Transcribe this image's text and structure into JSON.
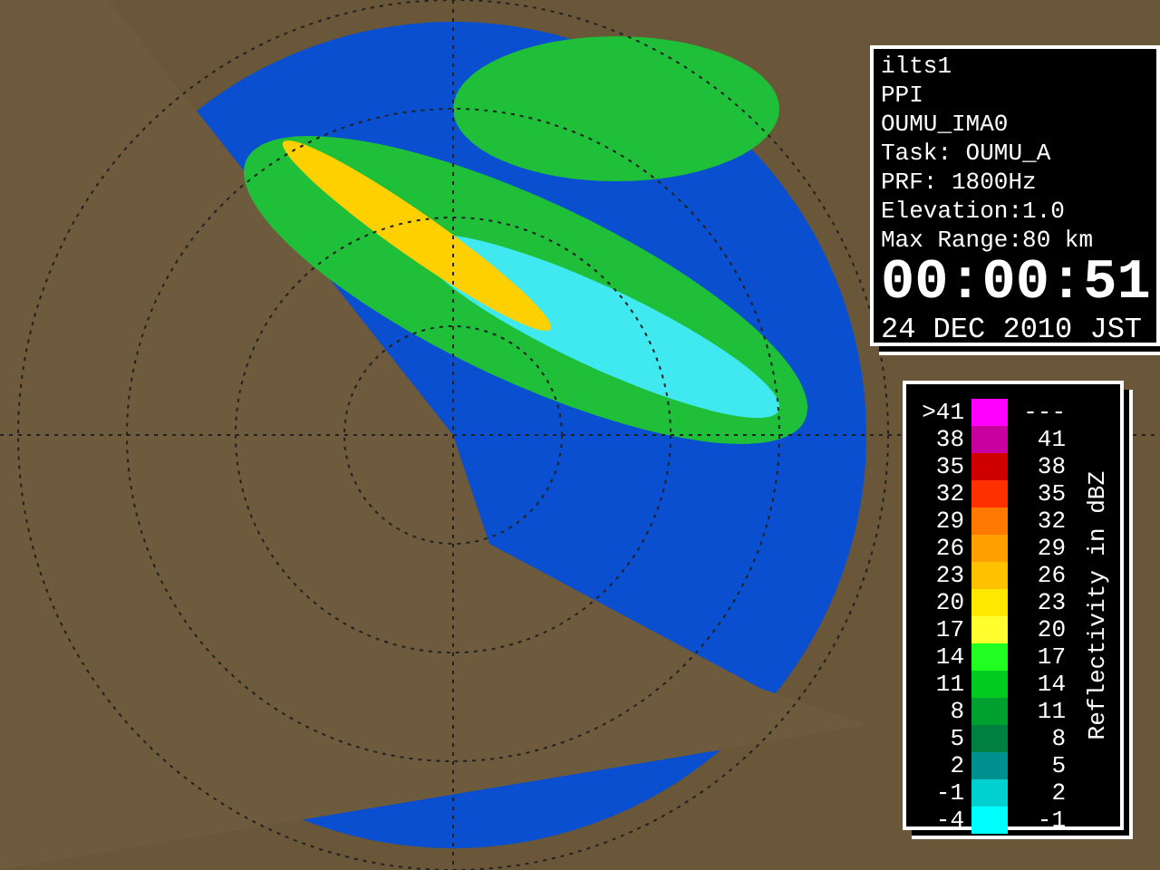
{
  "info_panel": {
    "lines": [
      "ilts1",
      "PPI",
      "OUMU_IMA0",
      "Task: OUMU_A",
      "PRF: 1800Hz",
      "Elevation:1.0",
      "Max Range:80 km"
    ],
    "time": "00:00:51",
    "date": "24 DEC 2010 JST"
  },
  "legend": {
    "title": "Reflectivity in dBZ",
    "rows": [
      {
        "low": ">41",
        "high": "---",
        "color": "#ff00ff"
      },
      {
        "low": "38",
        "high": "41",
        "color": "#c800a0"
      },
      {
        "low": "35",
        "high": "38",
        "color": "#d00000"
      },
      {
        "low": "32",
        "high": "35",
        "color": "#ff3000"
      },
      {
        "low": "29",
        "high": "32",
        "color": "#ff7800"
      },
      {
        "low": "26",
        "high": "29",
        "color": "#ffa000"
      },
      {
        "low": "23",
        "high": "26",
        "color": "#ffc000"
      },
      {
        "low": "20",
        "high": "23",
        "color": "#ffe800"
      },
      {
        "low": "17",
        "high": "20",
        "color": "#ffff30"
      },
      {
        "low": "14",
        "high": "17",
        "color": "#20ff20"
      },
      {
        "low": "11",
        "high": "14",
        "color": "#00cc20"
      },
      {
        "low": "8",
        "high": "11",
        "color": "#00a030"
      },
      {
        "low": "5",
        "high": "8",
        "color": "#008040"
      },
      {
        "low": "2",
        "high": "5",
        "color": "#009090"
      },
      {
        "low": "-1",
        "high": "2",
        "color": "#00d0d0"
      },
      {
        "low": "-4",
        "high": "-1",
        "color": "#00ffff"
      }
    ]
  }
}
